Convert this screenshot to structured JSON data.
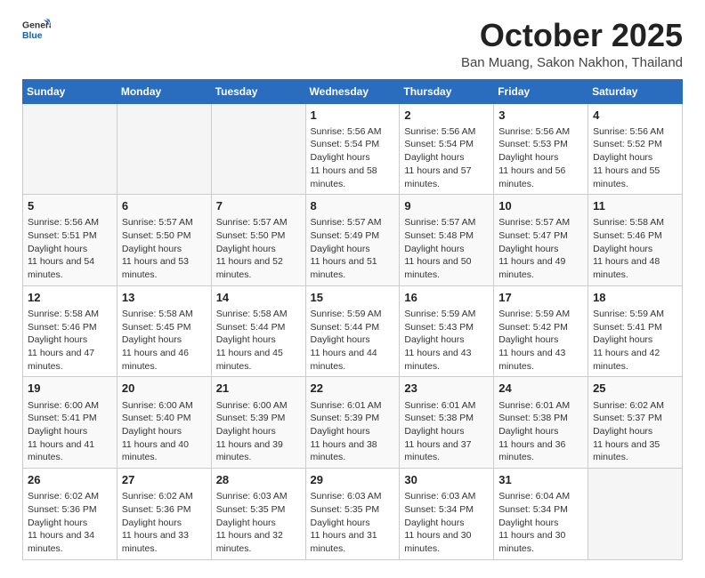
{
  "logo": {
    "line1": "General",
    "line2": "Blue"
  },
  "title": "October 2025",
  "subtitle": "Ban Muang, Sakon Nakhon, Thailand",
  "days_of_week": [
    "Sunday",
    "Monday",
    "Tuesday",
    "Wednesday",
    "Thursday",
    "Friday",
    "Saturday"
  ],
  "weeks": [
    [
      {
        "day": "",
        "info": ""
      },
      {
        "day": "",
        "info": ""
      },
      {
        "day": "",
        "info": ""
      },
      {
        "day": "1",
        "sunrise": "5:56 AM",
        "sunset": "5:54 PM",
        "daylight": "11 hours and 58 minutes."
      },
      {
        "day": "2",
        "sunrise": "5:56 AM",
        "sunset": "5:54 PM",
        "daylight": "11 hours and 57 minutes."
      },
      {
        "day": "3",
        "sunrise": "5:56 AM",
        "sunset": "5:53 PM",
        "daylight": "11 hours and 56 minutes."
      },
      {
        "day": "4",
        "sunrise": "5:56 AM",
        "sunset": "5:52 PM",
        "daylight": "11 hours and 55 minutes."
      }
    ],
    [
      {
        "day": "5",
        "sunrise": "5:56 AM",
        "sunset": "5:51 PM",
        "daylight": "11 hours and 54 minutes."
      },
      {
        "day": "6",
        "sunrise": "5:57 AM",
        "sunset": "5:50 PM",
        "daylight": "11 hours and 53 minutes."
      },
      {
        "day": "7",
        "sunrise": "5:57 AM",
        "sunset": "5:50 PM",
        "daylight": "11 hours and 52 minutes."
      },
      {
        "day": "8",
        "sunrise": "5:57 AM",
        "sunset": "5:49 PM",
        "daylight": "11 hours and 51 minutes."
      },
      {
        "day": "9",
        "sunrise": "5:57 AM",
        "sunset": "5:48 PM",
        "daylight": "11 hours and 50 minutes."
      },
      {
        "day": "10",
        "sunrise": "5:57 AM",
        "sunset": "5:47 PM",
        "daylight": "11 hours and 49 minutes."
      },
      {
        "day": "11",
        "sunrise": "5:58 AM",
        "sunset": "5:46 PM",
        "daylight": "11 hours and 48 minutes."
      }
    ],
    [
      {
        "day": "12",
        "sunrise": "5:58 AM",
        "sunset": "5:46 PM",
        "daylight": "11 hours and 47 minutes."
      },
      {
        "day": "13",
        "sunrise": "5:58 AM",
        "sunset": "5:45 PM",
        "daylight": "11 hours and 46 minutes."
      },
      {
        "day": "14",
        "sunrise": "5:58 AM",
        "sunset": "5:44 PM",
        "daylight": "11 hours and 45 minutes."
      },
      {
        "day": "15",
        "sunrise": "5:59 AM",
        "sunset": "5:44 PM",
        "daylight": "11 hours and 44 minutes."
      },
      {
        "day": "16",
        "sunrise": "5:59 AM",
        "sunset": "5:43 PM",
        "daylight": "11 hours and 43 minutes."
      },
      {
        "day": "17",
        "sunrise": "5:59 AM",
        "sunset": "5:42 PM",
        "daylight": "11 hours and 43 minutes."
      },
      {
        "day": "18",
        "sunrise": "5:59 AM",
        "sunset": "5:41 PM",
        "daylight": "11 hours and 42 minutes."
      }
    ],
    [
      {
        "day": "19",
        "sunrise": "6:00 AM",
        "sunset": "5:41 PM",
        "daylight": "11 hours and 41 minutes."
      },
      {
        "day": "20",
        "sunrise": "6:00 AM",
        "sunset": "5:40 PM",
        "daylight": "11 hours and 40 minutes."
      },
      {
        "day": "21",
        "sunrise": "6:00 AM",
        "sunset": "5:39 PM",
        "daylight": "11 hours and 39 minutes."
      },
      {
        "day": "22",
        "sunrise": "6:01 AM",
        "sunset": "5:39 PM",
        "daylight": "11 hours and 38 minutes."
      },
      {
        "day": "23",
        "sunrise": "6:01 AM",
        "sunset": "5:38 PM",
        "daylight": "11 hours and 37 minutes."
      },
      {
        "day": "24",
        "sunrise": "6:01 AM",
        "sunset": "5:38 PM",
        "daylight": "11 hours and 36 minutes."
      },
      {
        "day": "25",
        "sunrise": "6:02 AM",
        "sunset": "5:37 PM",
        "daylight": "11 hours and 35 minutes."
      }
    ],
    [
      {
        "day": "26",
        "sunrise": "6:02 AM",
        "sunset": "5:36 PM",
        "daylight": "11 hours and 34 minutes."
      },
      {
        "day": "27",
        "sunrise": "6:02 AM",
        "sunset": "5:36 PM",
        "daylight": "11 hours and 33 minutes."
      },
      {
        "day": "28",
        "sunrise": "6:03 AM",
        "sunset": "5:35 PM",
        "daylight": "11 hours and 32 minutes."
      },
      {
        "day": "29",
        "sunrise": "6:03 AM",
        "sunset": "5:35 PM",
        "daylight": "11 hours and 31 minutes."
      },
      {
        "day": "30",
        "sunrise": "6:03 AM",
        "sunset": "5:34 PM",
        "daylight": "11 hours and 30 minutes."
      },
      {
        "day": "31",
        "sunrise": "6:04 AM",
        "sunset": "5:34 PM",
        "daylight": "11 hours and 30 minutes."
      },
      {
        "day": "",
        "info": ""
      }
    ]
  ]
}
